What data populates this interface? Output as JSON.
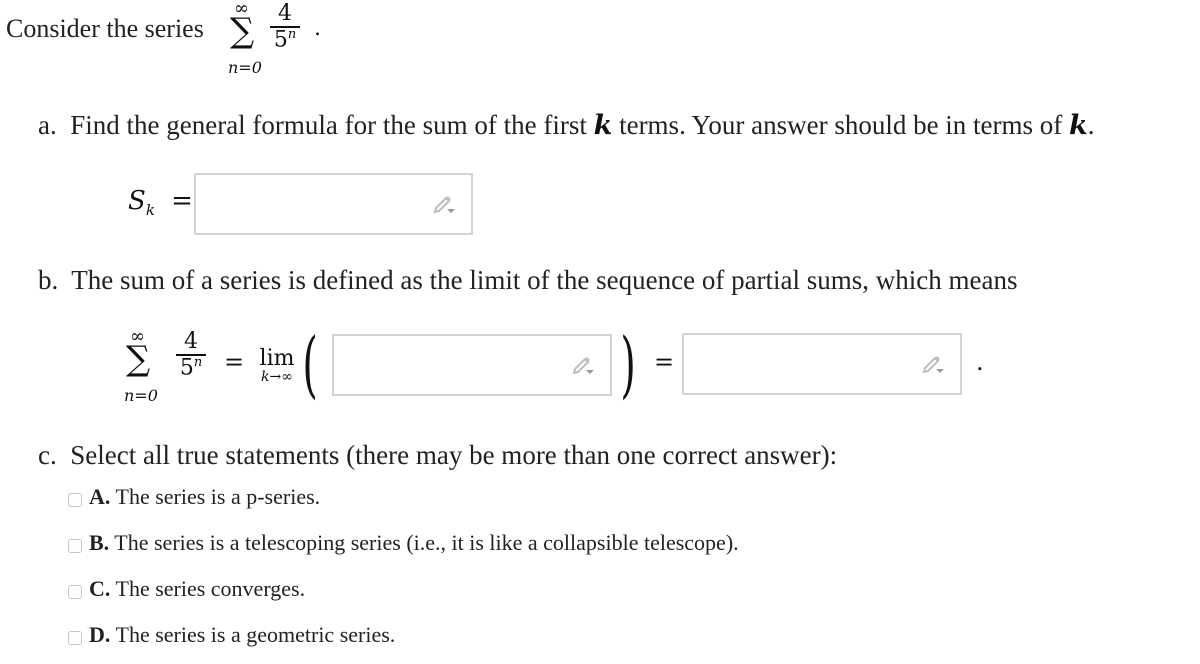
{
  "intro": {
    "text": "Consider the series",
    "series": {
      "sum_upper": "∞",
      "sum_lower": "n=0",
      "numerator": "4",
      "denominator_base": "5",
      "denominator_exp": "n",
      "trailing": "."
    }
  },
  "part_a": {
    "label": "a.",
    "text_before_k": "Find the general formula for the sum of the first",
    "k": "k",
    "text_after_k": "terms. Your answer should be in terms of",
    "k2": "k",
    "end": ".",
    "lhs_symbol": "S",
    "lhs_sub": "k",
    "equals": "=",
    "input_value": "",
    "input_icon": "pencil-dropdown-icon"
  },
  "part_b": {
    "label": "b.",
    "text": "The sum of a series is defined as the limit of the sequence of partial sums, which means",
    "sum_upper": "∞",
    "sum_lower": "n=0",
    "numerator": "4",
    "denominator_base": "5",
    "denominator_exp": "n",
    "equals1": "=",
    "lim": "lim",
    "lim_sub": "k→∞",
    "open_paren": "(",
    "close_paren": ")",
    "equals2": "=",
    "limit_input_value": "",
    "result_input_value": "",
    "trailing": "."
  },
  "part_c": {
    "label": "c.",
    "text": "Select all true statements (there may be more than one correct answer):",
    "options": [
      {
        "letter": "A.",
        "text": "The series is a p-series.",
        "checked": false
      },
      {
        "letter": "B.",
        "text": "The series is a telescoping series (i.e., it is like a collapsible telescope).",
        "checked": false
      },
      {
        "letter": "C.",
        "text": "The series converges.",
        "checked": false
      },
      {
        "letter": "D.",
        "text": "The series is a geometric series.",
        "checked": false
      }
    ]
  }
}
